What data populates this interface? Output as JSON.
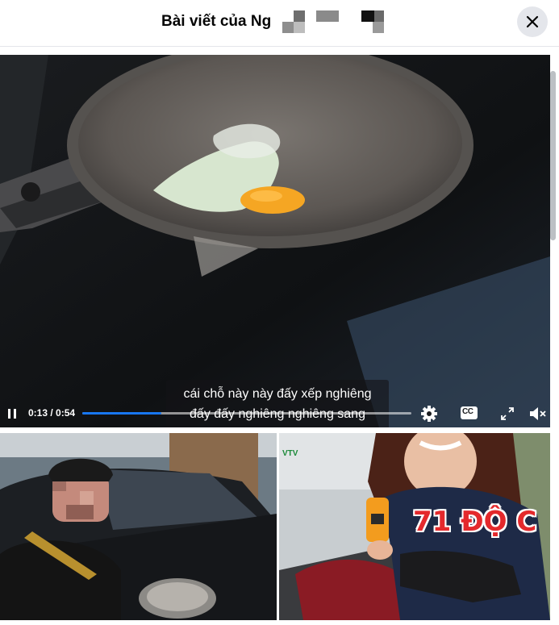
{
  "header": {
    "title": "Bài viết của Ng",
    "close_icon": "close-icon"
  },
  "video": {
    "subtitle_line1": "cái chỗ này này đấy xếp nghiêng",
    "subtitle_line2": "đấy đấy nghiêng nghiêng sang",
    "time": "0:13 / 0:54",
    "progress": 0.24,
    "icons": [
      "pause-icon",
      "settings-icon",
      "captions-icon",
      "fullscreen-icon",
      "mute-icon"
    ],
    "captions_label": "CC"
  },
  "thumbnails": [
    {
      "name": "car-hood-thumbnail"
    },
    {
      "name": "news-reporter-thumbnail",
      "overlay_text": "71 ĐỘ C",
      "logo_text": "VTV"
    }
  ],
  "colors": {
    "accent": "#1877f2",
    "close_bg": "#e4e6eb",
    "overlay_red": "#e4292c"
  }
}
